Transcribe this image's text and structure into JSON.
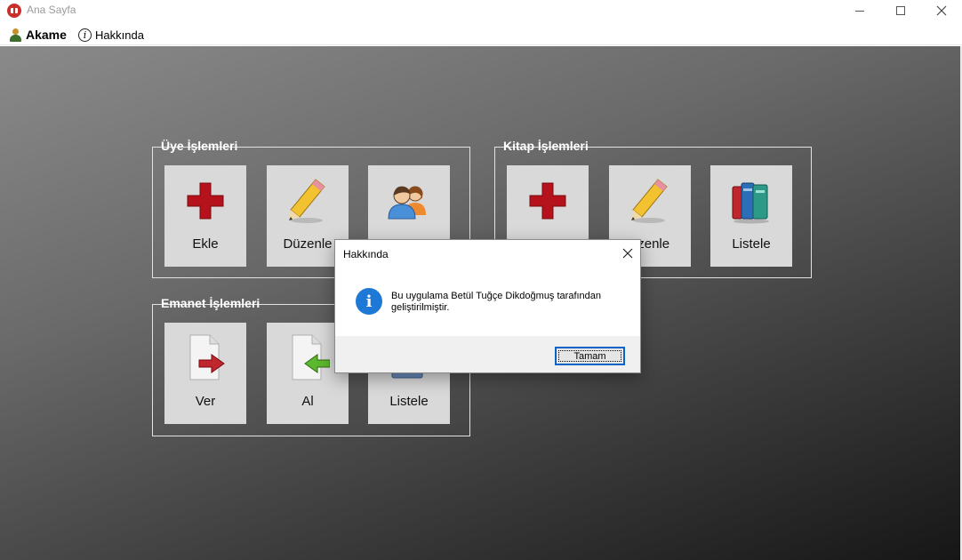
{
  "window": {
    "title": "Ana Sayfa",
    "controls": {
      "minimize": "minimize-icon",
      "maximize": "maximize-icon",
      "close": "close-icon"
    }
  },
  "menubar": {
    "items": [
      {
        "label": "Akame",
        "icon": "user-icon"
      },
      {
        "label": "Hakkında",
        "icon": "info-icon"
      }
    ]
  },
  "groups": {
    "uye": {
      "title": "Üye İşlemleri",
      "tiles": [
        {
          "label": "Ekle",
          "icon": "red-plus-icon"
        },
        {
          "label": "Düzenle",
          "icon": "pencil-icon"
        },
        {
          "label": "",
          "icon": "users-icon"
        }
      ]
    },
    "kitap": {
      "title": "Kitap İşlemleri",
      "tiles": [
        {
          "label": "",
          "icon": "red-plus-icon"
        },
        {
          "label": "üzenle",
          "icon": "pencil-icon"
        },
        {
          "label": "Listele",
          "icon": "books-icon"
        }
      ]
    },
    "emanet": {
      "title": "Emanet İşlemleri",
      "tiles": [
        {
          "label": "Ver",
          "icon": "document-arrow-right-icon"
        },
        {
          "label": "Al",
          "icon": "document-arrow-left-icon"
        },
        {
          "label": "Listele",
          "icon": "book-list-icon"
        }
      ]
    }
  },
  "dialog": {
    "title": "Hakkında",
    "icon": "info-icon",
    "message": "Bu uygulama Betül Tuğçe Dikdoğmuş tarafından geliştirilmiştir.",
    "button": "Tamam",
    "colors": {
      "info": "#1e78d6",
      "focus": "#0a64c8"
    }
  }
}
